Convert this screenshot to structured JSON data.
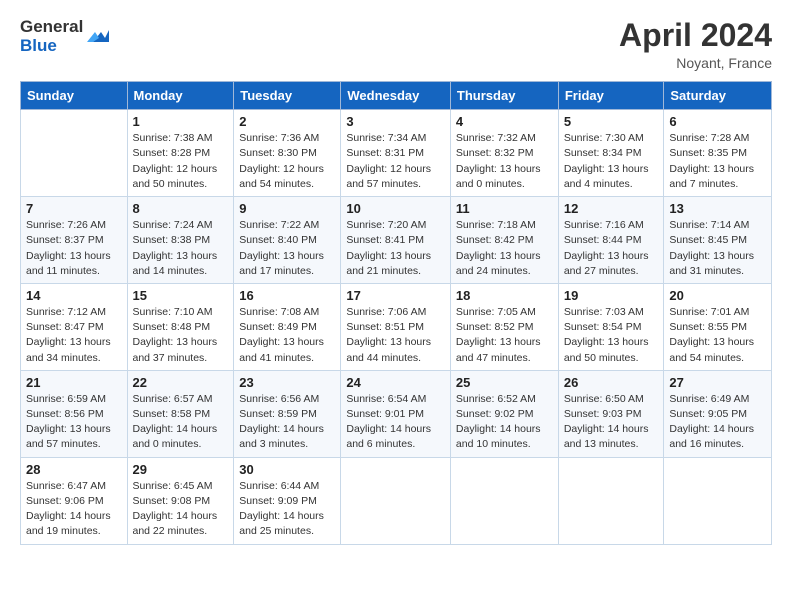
{
  "header": {
    "logo_general": "General",
    "logo_blue": "Blue",
    "month_title": "April 2024",
    "location": "Noyant, France"
  },
  "weekdays": [
    "Sunday",
    "Monday",
    "Tuesday",
    "Wednesday",
    "Thursday",
    "Friday",
    "Saturday"
  ],
  "weeks": [
    [
      {
        "day": "",
        "info": ""
      },
      {
        "day": "1",
        "info": "Sunrise: 7:38 AM\nSunset: 8:28 PM\nDaylight: 12 hours\nand 50 minutes."
      },
      {
        "day": "2",
        "info": "Sunrise: 7:36 AM\nSunset: 8:30 PM\nDaylight: 12 hours\nand 54 minutes."
      },
      {
        "day": "3",
        "info": "Sunrise: 7:34 AM\nSunset: 8:31 PM\nDaylight: 12 hours\nand 57 minutes."
      },
      {
        "day": "4",
        "info": "Sunrise: 7:32 AM\nSunset: 8:32 PM\nDaylight: 13 hours\nand 0 minutes."
      },
      {
        "day": "5",
        "info": "Sunrise: 7:30 AM\nSunset: 8:34 PM\nDaylight: 13 hours\nand 4 minutes."
      },
      {
        "day": "6",
        "info": "Sunrise: 7:28 AM\nSunset: 8:35 PM\nDaylight: 13 hours\nand 7 minutes."
      }
    ],
    [
      {
        "day": "7",
        "info": "Sunrise: 7:26 AM\nSunset: 8:37 PM\nDaylight: 13 hours\nand 11 minutes."
      },
      {
        "day": "8",
        "info": "Sunrise: 7:24 AM\nSunset: 8:38 PM\nDaylight: 13 hours\nand 14 minutes."
      },
      {
        "day": "9",
        "info": "Sunrise: 7:22 AM\nSunset: 8:40 PM\nDaylight: 13 hours\nand 17 minutes."
      },
      {
        "day": "10",
        "info": "Sunrise: 7:20 AM\nSunset: 8:41 PM\nDaylight: 13 hours\nand 21 minutes."
      },
      {
        "day": "11",
        "info": "Sunrise: 7:18 AM\nSunset: 8:42 PM\nDaylight: 13 hours\nand 24 minutes."
      },
      {
        "day": "12",
        "info": "Sunrise: 7:16 AM\nSunset: 8:44 PM\nDaylight: 13 hours\nand 27 minutes."
      },
      {
        "day": "13",
        "info": "Sunrise: 7:14 AM\nSunset: 8:45 PM\nDaylight: 13 hours\nand 31 minutes."
      }
    ],
    [
      {
        "day": "14",
        "info": "Sunrise: 7:12 AM\nSunset: 8:47 PM\nDaylight: 13 hours\nand 34 minutes."
      },
      {
        "day": "15",
        "info": "Sunrise: 7:10 AM\nSunset: 8:48 PM\nDaylight: 13 hours\nand 37 minutes."
      },
      {
        "day": "16",
        "info": "Sunrise: 7:08 AM\nSunset: 8:49 PM\nDaylight: 13 hours\nand 41 minutes."
      },
      {
        "day": "17",
        "info": "Sunrise: 7:06 AM\nSunset: 8:51 PM\nDaylight: 13 hours\nand 44 minutes."
      },
      {
        "day": "18",
        "info": "Sunrise: 7:05 AM\nSunset: 8:52 PM\nDaylight: 13 hours\nand 47 minutes."
      },
      {
        "day": "19",
        "info": "Sunrise: 7:03 AM\nSunset: 8:54 PM\nDaylight: 13 hours\nand 50 minutes."
      },
      {
        "day": "20",
        "info": "Sunrise: 7:01 AM\nSunset: 8:55 PM\nDaylight: 13 hours\nand 54 minutes."
      }
    ],
    [
      {
        "day": "21",
        "info": "Sunrise: 6:59 AM\nSunset: 8:56 PM\nDaylight: 13 hours\nand 57 minutes."
      },
      {
        "day": "22",
        "info": "Sunrise: 6:57 AM\nSunset: 8:58 PM\nDaylight: 14 hours\nand 0 minutes."
      },
      {
        "day": "23",
        "info": "Sunrise: 6:56 AM\nSunset: 8:59 PM\nDaylight: 14 hours\nand 3 minutes."
      },
      {
        "day": "24",
        "info": "Sunrise: 6:54 AM\nSunset: 9:01 PM\nDaylight: 14 hours\nand 6 minutes."
      },
      {
        "day": "25",
        "info": "Sunrise: 6:52 AM\nSunset: 9:02 PM\nDaylight: 14 hours\nand 10 minutes."
      },
      {
        "day": "26",
        "info": "Sunrise: 6:50 AM\nSunset: 9:03 PM\nDaylight: 14 hours\nand 13 minutes."
      },
      {
        "day": "27",
        "info": "Sunrise: 6:49 AM\nSunset: 9:05 PM\nDaylight: 14 hours\nand 16 minutes."
      }
    ],
    [
      {
        "day": "28",
        "info": "Sunrise: 6:47 AM\nSunset: 9:06 PM\nDaylight: 14 hours\nand 19 minutes."
      },
      {
        "day": "29",
        "info": "Sunrise: 6:45 AM\nSunset: 9:08 PM\nDaylight: 14 hours\nand 22 minutes."
      },
      {
        "day": "30",
        "info": "Sunrise: 6:44 AM\nSunset: 9:09 PM\nDaylight: 14 hours\nand 25 minutes."
      },
      {
        "day": "",
        "info": ""
      },
      {
        "day": "",
        "info": ""
      },
      {
        "day": "",
        "info": ""
      },
      {
        "day": "",
        "info": ""
      }
    ]
  ]
}
